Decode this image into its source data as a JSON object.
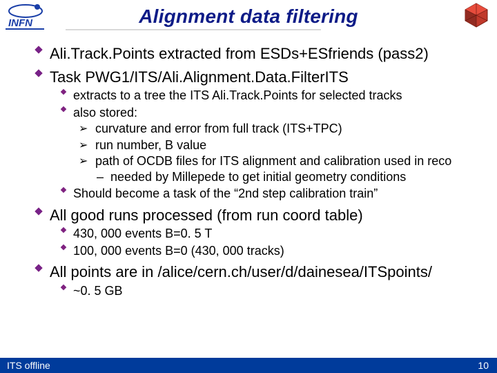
{
  "title": "Alignment data filtering",
  "bullets": {
    "l1": {
      "i0": "Ali.Track.Points extracted from ESDs+ESfriends (pass2)",
      "i1": "Task PWG1/ITS/Ali.Alignment.Data.FilterITS",
      "i2": "All good runs processed (from run coord table)",
      "i3": "All points are in /alice/cern.ch/user/d/dainesea/ITSpoints/"
    },
    "s1": {
      "a": "extracts to a tree the ITS Ali.Track.Points for selected tracks",
      "b": "also stored:",
      "c": "Should become a task of the “2nd step calibration train”"
    },
    "s1arrows": {
      "x": "curvature and error from full track (ITS+TPC)",
      "y": "run number, B value",
      "z": "path of OCDB files for ITS alignment and calibration used in reco"
    },
    "s1dash": {
      "a": "needed by Millepede to get initial geometry conditions"
    },
    "s2": {
      "a": "430, 000 events B=0. 5 T",
      "b": "100, 000 events B=0 (430, 000 tracks)"
    },
    "s3": {
      "a": "~0. 5 GB"
    }
  },
  "footer": {
    "left": "ITS offline",
    "right": "10"
  },
  "icons": {
    "infn": "INFN",
    "detector": "detector-icon"
  }
}
